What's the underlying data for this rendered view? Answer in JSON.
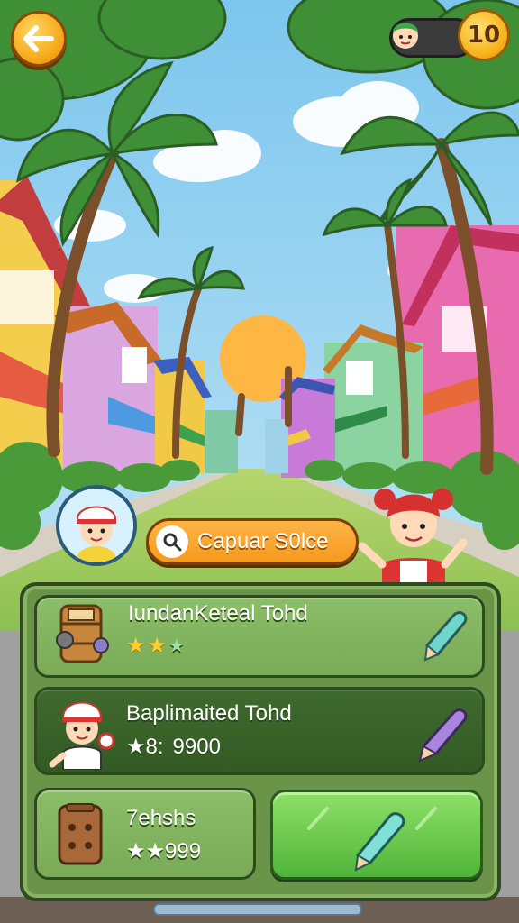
{
  "hud": {
    "coins": "10",
    "back_icon": "arrow-left-icon"
  },
  "profile": {
    "avatar_icon": "chef-boy-avatar"
  },
  "search": {
    "label": "Capuar S0lce",
    "icon": "magnifier-icon"
  },
  "cards": [
    {
      "title": "IundanKeteal Tohd",
      "stars": 2,
      "extra_stars": 1,
      "value": "",
      "item_icon": "barrel-crate-icon",
      "tool_icon": "teal-crayon-icon"
    },
    {
      "title": "Baplimaited Tohd",
      "star_prefix": "★8:",
      "value": "9900",
      "item_icon": "chef-character-icon",
      "tool_icon": "purple-crayon-icon"
    },
    {
      "title": "7ehshs",
      "value": "★★999",
      "item_icon": "wooden-box-icon"
    }
  ],
  "action_button": {
    "icon": "teal-crayon-icon"
  },
  "colors": {
    "panel": "#6a9448",
    "accent_orange": "#f59a1c",
    "action_green": "#4fb53a"
  }
}
